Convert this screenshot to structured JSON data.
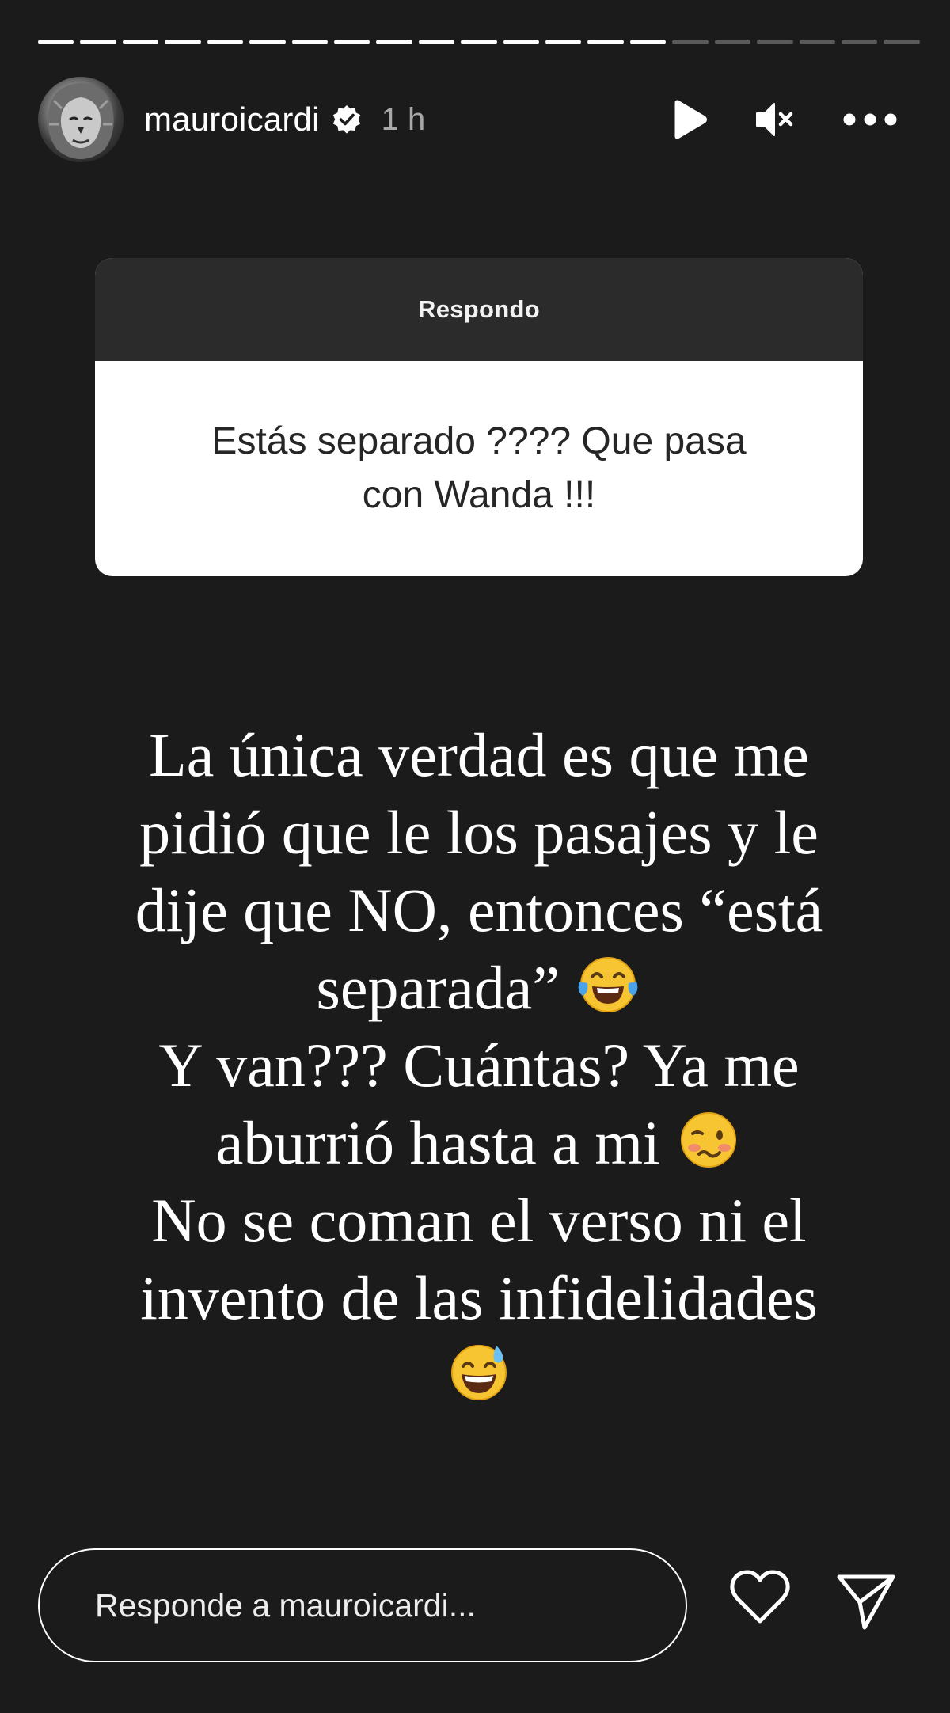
{
  "progress": {
    "segments_total": 21,
    "segments_complete": 15,
    "current_segment_fill": 0.0
  },
  "header": {
    "username": "mauroicardi",
    "verified": true,
    "time": "1 h",
    "icons": [
      "play-icon",
      "muted-icon",
      "more-icon"
    ]
  },
  "sticker": {
    "title": "Respondo",
    "question_lines": [
      "Estás separado ???? Que pasa",
      "con Wanda !!!"
    ]
  },
  "story": {
    "lines": [
      "La única verdad es que me",
      "pidió que le los pasajes y le",
      "dije que NO, entonces “está",
      "separada”",
      "Y van??? Cuántas? Ya me",
      "aburrió hasta a mi",
      "No se coman el verso ni el",
      "invento de las infidelidades"
    ],
    "emojis": [
      "face-with-tears-of-joy",
      "woozy-face",
      "grinning-face-with-sweat"
    ]
  },
  "footer": {
    "reply_placeholder": "Responde a mauroicardi...",
    "icons": [
      "heart-icon",
      "send-icon"
    ]
  },
  "colors": {
    "background": "#1b1b1b",
    "sticker_header": "#2b2b2b",
    "sticker_body": "#ffffff",
    "progress_done": "#ffffff",
    "progress_pending": "#5a5a5a",
    "verified_badge": "#ffffff",
    "muted_text": "#a8a8a8"
  }
}
